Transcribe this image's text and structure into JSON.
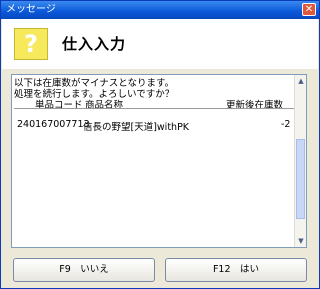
{
  "window": {
    "title": "メッセージ"
  },
  "header": {
    "icon_glyph": "?",
    "title": "仕入入力"
  },
  "message": {
    "line1": "以下は在庫数がマイナスとなります。",
    "line2": "処理を続行します。よろしいですか？",
    "columns": {
      "product_code": "単品コード",
      "product_name": "商品名称",
      "stock": "更新後在庫数"
    },
    "rows": [
      {
        "product_code": "240167007713",
        "product_name": "信長の野望[天道]withPK",
        "stock": "-2"
      }
    ]
  },
  "buttons": {
    "no": "F9　いいえ",
    "yes": "F12　はい"
  }
}
